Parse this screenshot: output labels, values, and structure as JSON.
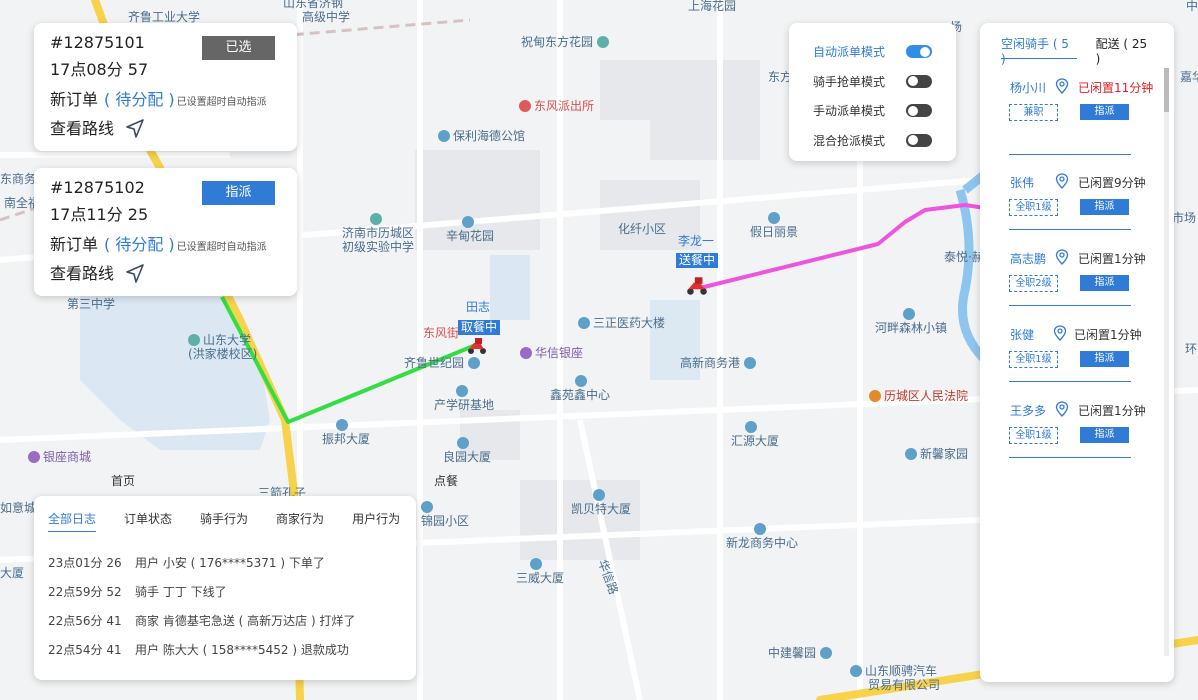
{
  "orders": [
    {
      "id": "#12875101",
      "time": "17点08分 57",
      "status": "新订单",
      "pending": "( 待分配 )",
      "note": "已设置超时自动指派",
      "route_label": "查看路线",
      "button": "已选"
    },
    {
      "id": "#12875102",
      "time": "17点11分 25",
      "status": "新订单",
      "pending": "( 待分配 )",
      "note": "已设置超时自动指派",
      "route_label": "查看路线",
      "button": "指派"
    }
  ],
  "modes": [
    {
      "label": "自动派单模式",
      "on": true
    },
    {
      "label": "骑手抢单模式",
      "on": false
    },
    {
      "label": "手动派单模式",
      "on": false
    },
    {
      "label": "混合抢派模式",
      "on": false
    }
  ],
  "riders_panel": {
    "tab_idle": "空闲骑手 ( 5 )",
    "tab_delivering": "配送 ( 25 )",
    "riders": [
      {
        "name": "杨小川",
        "idle": "已闲置11分钟",
        "level": "兼职",
        "assign": "指派",
        "highlight": true
      },
      {
        "name": "张伟",
        "idle": "已闲置9分钟",
        "level": "全职1级",
        "assign": "指派",
        "highlight": false
      },
      {
        "name": "高志鹏",
        "idle": "已闲置1分钟",
        "level": "全职2级",
        "assign": "指派",
        "highlight": false
      },
      {
        "name": "张健",
        "idle": "已闲置1分钟",
        "level": "全职1级",
        "assign": "指派",
        "highlight": false
      },
      {
        "name": "王多多",
        "idle": "已闲置1分钟",
        "level": "全职1级",
        "assign": "指派",
        "highlight": false
      }
    ]
  },
  "logs": {
    "tabs": [
      "全部日志",
      "订单状态",
      "骑手行为",
      "商家行为",
      "用户行为"
    ],
    "rows": [
      {
        "time": "23点01分 26",
        "text": "用户 小安 ( 176****5371 ) 下单了"
      },
      {
        "time": "22点59分 52",
        "text": "骑手 丁丁 下线了"
      },
      {
        "time": "22点56分 41",
        "text": "商家 肯德基宅急送 ( 高新万达店 ) 打烊了"
      },
      {
        "time": "22点54分 41",
        "text": "用户 陈大大 ( 158****5452 ) 退款成功"
      }
    ]
  },
  "map": {
    "riders": [
      {
        "name": "田志",
        "status": "取餐中"
      },
      {
        "name": "李龙一",
        "status": "送餐中"
      }
    ],
    "pois": {
      "p1": "齐鲁工业大学",
      "p2": "山东省济钢",
      "p2b": "高级中学",
      "p3": "上海花园",
      "p4": "祝甸东方花园",
      "p5": "东风派出所",
      "p6": "保利海德公馆",
      "p7": "东方",
      "p8": "化纤小区",
      "p9": "假日丽景",
      "p10": "济南市历城区",
      "p10b": "初级实验中学",
      "p11": "辛甸花园",
      "p12": "第三中学",
      "p13": "山东大学",
      "p13b": "(洪家楼校区)",
      "p14": "东风街",
      "p15": "齐鲁世纪园",
      "p16": "华信银座",
      "p17": "三正医药大楼",
      "p18": "高新商务港",
      "p19": "产学研基地",
      "p20": "鑫苑鑫中心",
      "p21": "振邦大厦",
      "p22": "银座商城",
      "p23": "良园大厦",
      "p24": "汇源大厦",
      "p25": "历城区人民法院",
      "p26": "新馨家园",
      "p27": "河畔森林小镇",
      "p28": "泰悦·赫",
      "p29": "首页",
      "p30": "点餐",
      "p31": "凯贝特大厦",
      "p32": "锦园小区",
      "p33": "新龙商务中心",
      "p34": "三威大厦",
      "p35": "华信路",
      "p36": "中建馨园",
      "p37": "山东顺骋汽车",
      "p37b": "贸易有限公司",
      "p38": "中海紫",
      "p39": "嘉华",
      "p40": "市场",
      "p41": "环",
      "p42": "南全福",
      "p43": "东商务k",
      "p44": "三箭孔子",
      "p45": "如意城",
      "p46": "大厦",
      "p47": "场"
    }
  },
  "colors": {
    "accent": "#2f7bd6",
    "route_pickup": "#33dd44",
    "route_delivery": "#ee55dd",
    "road_yellow": "#f7d24a",
    "river": "#8ec5ee",
    "idle_alert": "#e02020"
  }
}
